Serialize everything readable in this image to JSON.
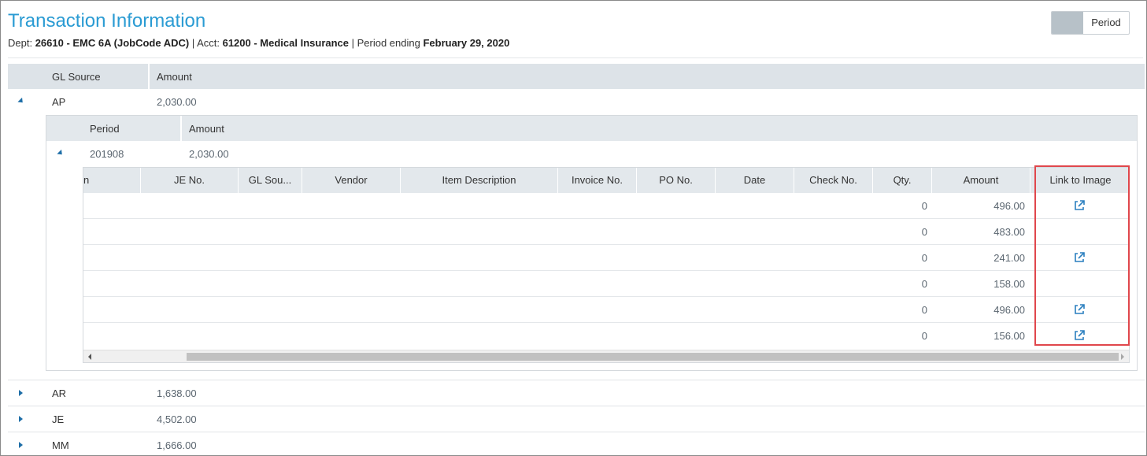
{
  "header": {
    "title": "Transaction Information",
    "dept_label": "Dept: ",
    "dept_value": "26610 - EMC 6A (JobCode ADC)",
    "acct_label": " | Acct: ",
    "acct_value": "61200 - Medical Insurance",
    "period_label": " | Period ending ",
    "period_value": "February 29, 2020",
    "toggle_label": "Period"
  },
  "outer_grid": {
    "columns": [
      "GL Source",
      "Amount"
    ],
    "rows": [
      {
        "source": "AP",
        "amount": "2,030.00",
        "expanded": true
      },
      {
        "source": "AR",
        "amount": "1,638.00",
        "expanded": false
      },
      {
        "source": "JE",
        "amount": "4,502.00",
        "expanded": false
      },
      {
        "source": "MM",
        "amount": "1,666.00",
        "expanded": false
      }
    ]
  },
  "period_grid": {
    "columns": [
      "Period",
      "Amount"
    ],
    "rows": [
      {
        "period": "201908",
        "amount": "2,030.00",
        "expanded": true
      }
    ]
  },
  "detail_grid": {
    "columns": [
      "n",
      "JE No.",
      "GL Sou...",
      "Vendor",
      "Item Description",
      "Invoice No.",
      "PO No.",
      "Date",
      "Check No.",
      "Qty.",
      "Amount",
      "Link to Image"
    ],
    "rows": [
      {
        "qty": "0",
        "amount": "496.00",
        "has_link": true
      },
      {
        "qty": "0",
        "amount": "483.00",
        "has_link": false
      },
      {
        "qty": "0",
        "amount": "241.00",
        "has_link": true
      },
      {
        "qty": "0",
        "amount": "158.00",
        "has_link": false
      },
      {
        "qty": "0",
        "amount": "496.00",
        "has_link": true
      },
      {
        "qty": "0",
        "amount": "156.00",
        "has_link": true
      }
    ]
  },
  "colors": {
    "title": "#2a9bd3",
    "link_icon": "#2a7fbf",
    "highlight": "#e0474c"
  },
  "icons": {
    "expand": "triangle-down-icon",
    "collapse": "triangle-right-icon",
    "link": "external-link-icon"
  }
}
